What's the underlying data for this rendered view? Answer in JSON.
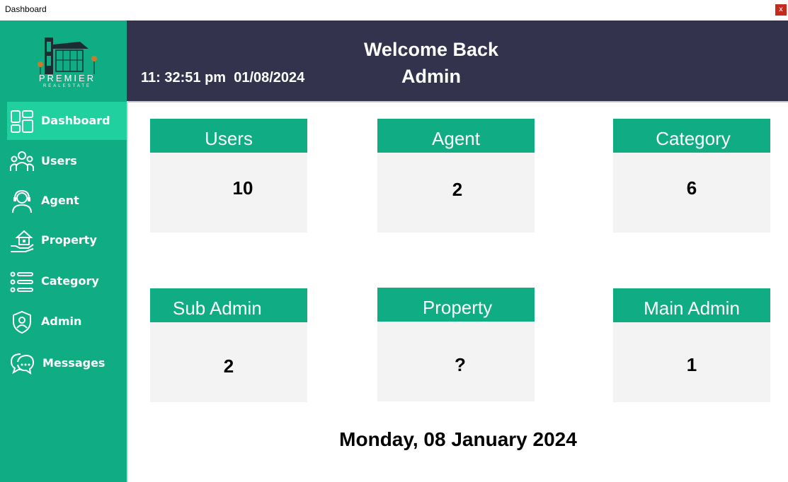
{
  "window": {
    "title": "Dashboard",
    "close_label": "x"
  },
  "brand": {
    "name": "PREMIER",
    "tagline": "REALESTATE"
  },
  "sidebar": {
    "items": [
      {
        "label": "Dashboard",
        "icon": "dashboard-icon",
        "active": true
      },
      {
        "label": "Users",
        "icon": "users-icon"
      },
      {
        "label": "Agent",
        "icon": "agent-icon"
      },
      {
        "label": "Property",
        "icon": "property-icon"
      },
      {
        "label": "Category",
        "icon": "category-icon"
      },
      {
        "label": "Admin",
        "icon": "admin-shield-icon"
      },
      {
        "label": "Messages",
        "icon": "messages-icon"
      }
    ]
  },
  "header": {
    "welcome_line1": "Welcome Back",
    "welcome_line2": "Admin",
    "time": "11: 32:51 pm",
    "date": "01/08/2024"
  },
  "cards": [
    {
      "title": "Users",
      "value": "10"
    },
    {
      "title": "Agent",
      "value": "2"
    },
    {
      "title": "Category",
      "value": "6"
    },
    {
      "title": "Sub Admin",
      "value": "2"
    },
    {
      "title": "Property",
      "value": "?"
    },
    {
      "title": "Main Admin",
      "value": "1"
    }
  ],
  "footer": {
    "long_date": "Monday, 08 January 2024"
  },
  "colors": {
    "sidebar": "#10ad85",
    "sidebar_active": "#20d19f",
    "header": "#33334d",
    "card_head": "#10ad85",
    "card_body": "#f3f3f3"
  }
}
